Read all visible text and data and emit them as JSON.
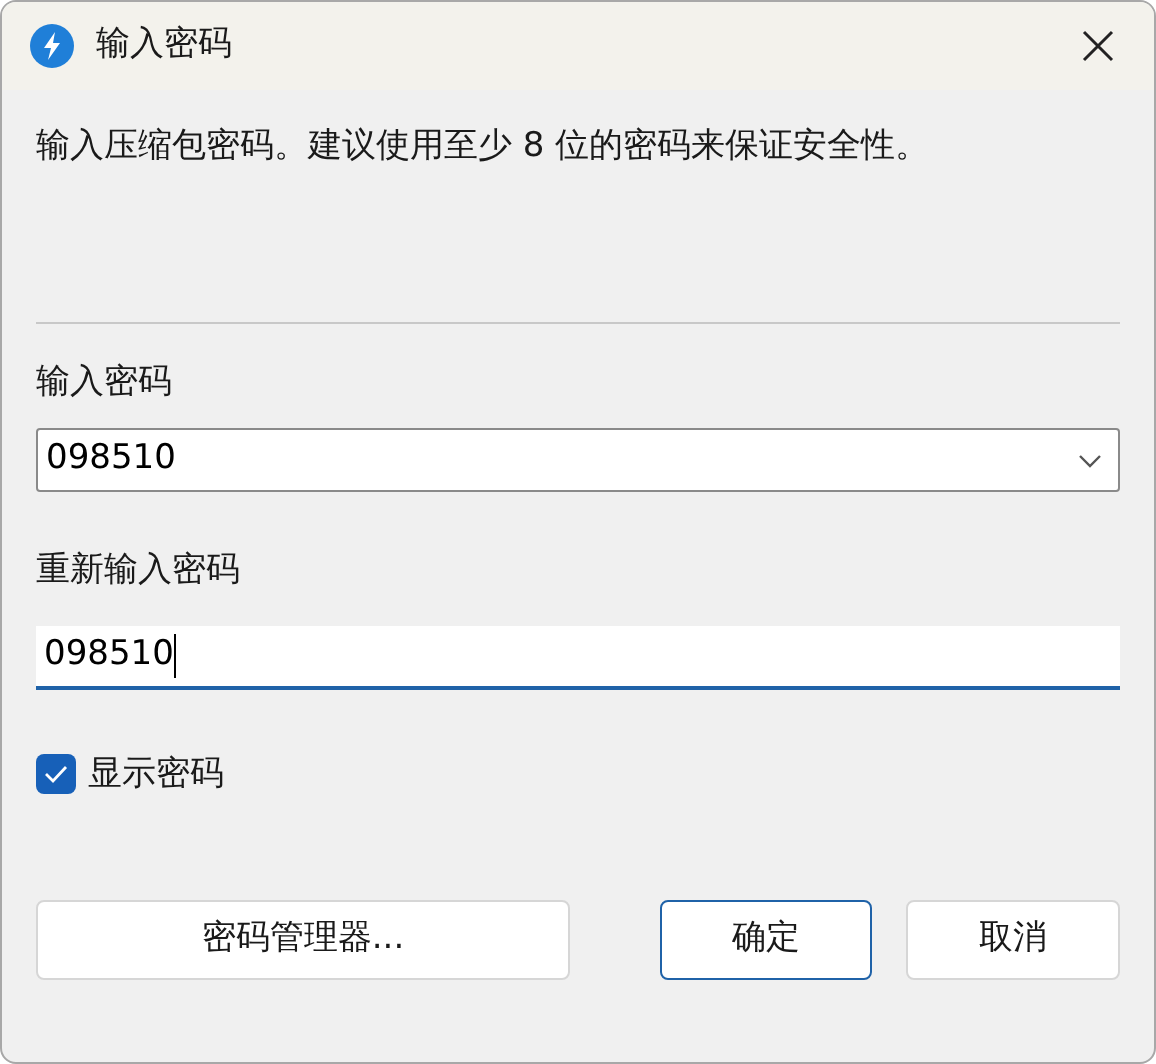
{
  "window": {
    "title": "输入密码"
  },
  "description": "输入压缩包密码。建议使用至少 8 位的密码来保证安全性。",
  "password": {
    "label": "输入密码",
    "value": "098510"
  },
  "confirm": {
    "label": "重新输入密码",
    "value": "098510",
    "focused": true
  },
  "show_password": {
    "label": "显示密码",
    "checked": true
  },
  "buttons": [
    {
      "label": "密码管理器...",
      "default": false
    },
    {
      "label": "确定",
      "default": true
    },
    {
      "label": "取消",
      "default": false
    }
  ]
}
